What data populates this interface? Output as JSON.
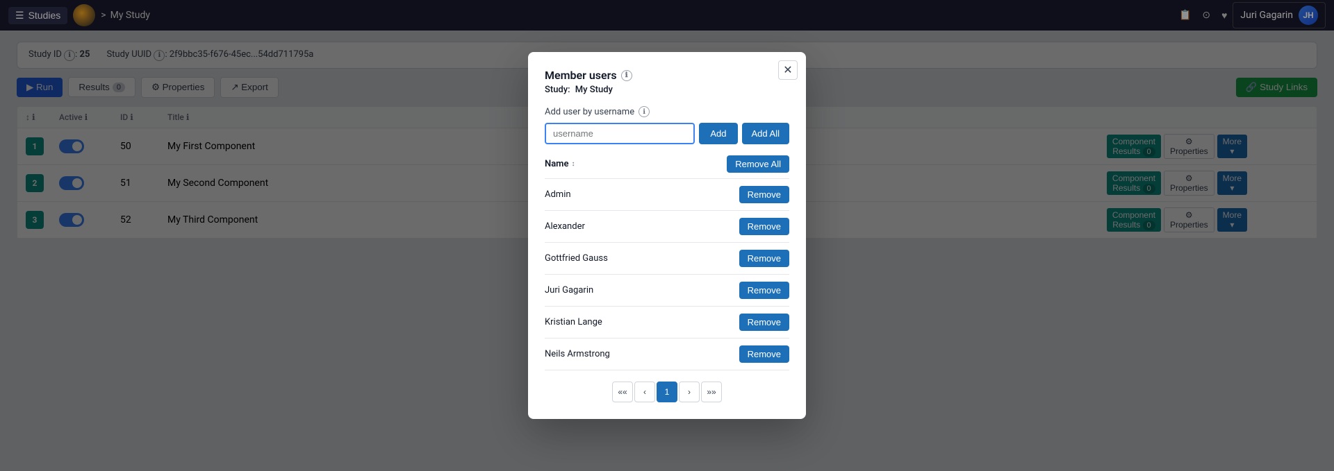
{
  "topnav": {
    "studies_label": "Studies",
    "breadcrumb_separator": ">",
    "study_name": "My Study",
    "user_name": "Juri Gagarin",
    "user_initials": "JH"
  },
  "study_info": {
    "id_label": "Study ID",
    "id_icon": "ℹ",
    "id_value": "25",
    "uuid_label": "Study UUID",
    "uuid_icon": "ℹ",
    "uuid_value": "2f9bbc35-f676-45ec...54dd711795a"
  },
  "actions": {
    "run": "▶ Run",
    "results": "Results",
    "results_count": "0",
    "properties": "⚙ Properties",
    "export": "↗ Export",
    "study_links": "🔗 Study Links"
  },
  "table": {
    "headers": [
      "↕ ℹ",
      "Active ℹ",
      "ID ℹ",
      "Title ℹ",
      "",
      "",
      ""
    ],
    "rows": [
      {
        "num": "1",
        "num_color": "#0d9488",
        "active": true,
        "id": "50",
        "title": "My First Component",
        "actions": [
          "Component Results 0",
          "Properties",
          "More"
        ]
      },
      {
        "num": "2",
        "num_color": "#0d9488",
        "active": true,
        "id": "51",
        "title": "My Second Component",
        "actions": [
          "Component Results 0",
          "Properties",
          "More"
        ]
      },
      {
        "num": "3",
        "num_color": "#0d9488",
        "active": true,
        "id": "52",
        "title": "My Third Component",
        "actions": [
          "Component Results 0",
          "Properties",
          "More"
        ]
      }
    ]
  },
  "modal": {
    "title": "Member users",
    "title_icon": "ℹ",
    "study_label": "Study:",
    "study_name": "My Study",
    "add_label": "Add user by username",
    "add_icon": "ℹ",
    "input_placeholder": "username",
    "btn_add": "Add",
    "btn_add_all": "Add All",
    "btn_remove_all": "Remove All",
    "name_header": "Name",
    "sort_icon": "↕",
    "members": [
      {
        "name": "Admin"
      },
      {
        "name": "Alexander"
      },
      {
        "name": "Gottfried Gauss"
      },
      {
        "name": "Juri Gagarin"
      },
      {
        "name": "Kristian Lange"
      },
      {
        "name": "Neils Armstrong"
      }
    ],
    "btn_remove": "Remove",
    "pagination": {
      "first": "««",
      "prev": "‹",
      "current": "1",
      "next": "›",
      "last": "»»"
    }
  }
}
